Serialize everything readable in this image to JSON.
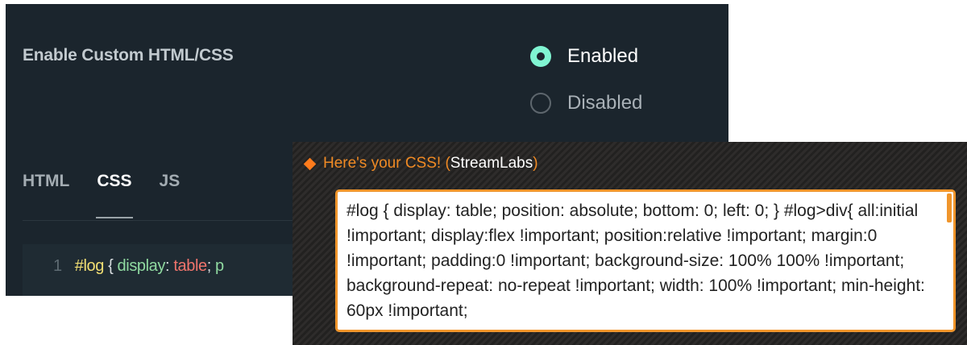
{
  "setting": {
    "label": "Enable Custom HTML/CSS",
    "options": [
      {
        "label": "Enabled",
        "checked": true
      },
      {
        "label": "Disabled",
        "checked": false
      }
    ]
  },
  "tabs": [
    {
      "label": "HTML",
      "active": false
    },
    {
      "label": "CSS",
      "active": true
    },
    {
      "label": "JS",
      "active": false
    }
  ],
  "editor": {
    "line_number": "1",
    "tokens": {
      "selector": "#log",
      "brace": " { ",
      "prop": "display",
      "colon": ": ",
      "value": "table",
      "semicolon": "; ",
      "trail": "p"
    }
  },
  "popup": {
    "title_prefix": "Here's your CSS! (",
    "title_brand": "StreamLabs",
    "title_suffix": ")",
    "code": "#log { display: table; position: absolute; bottom: 0; left: 0; } #log>div{ all:initial !important; display:flex !important; position:relative !important; margin:0 !important; padding:0 !important; background-size: 100% 100% !important; background-repeat: no-repeat !important; width: 100% !important; min-height: 60px !important;"
  },
  "colors": {
    "panel_bg": "#1b252d",
    "radio_accent": "#80f5d2",
    "popup_accent": "#f0952b",
    "diamond": "#ff7b1c"
  }
}
